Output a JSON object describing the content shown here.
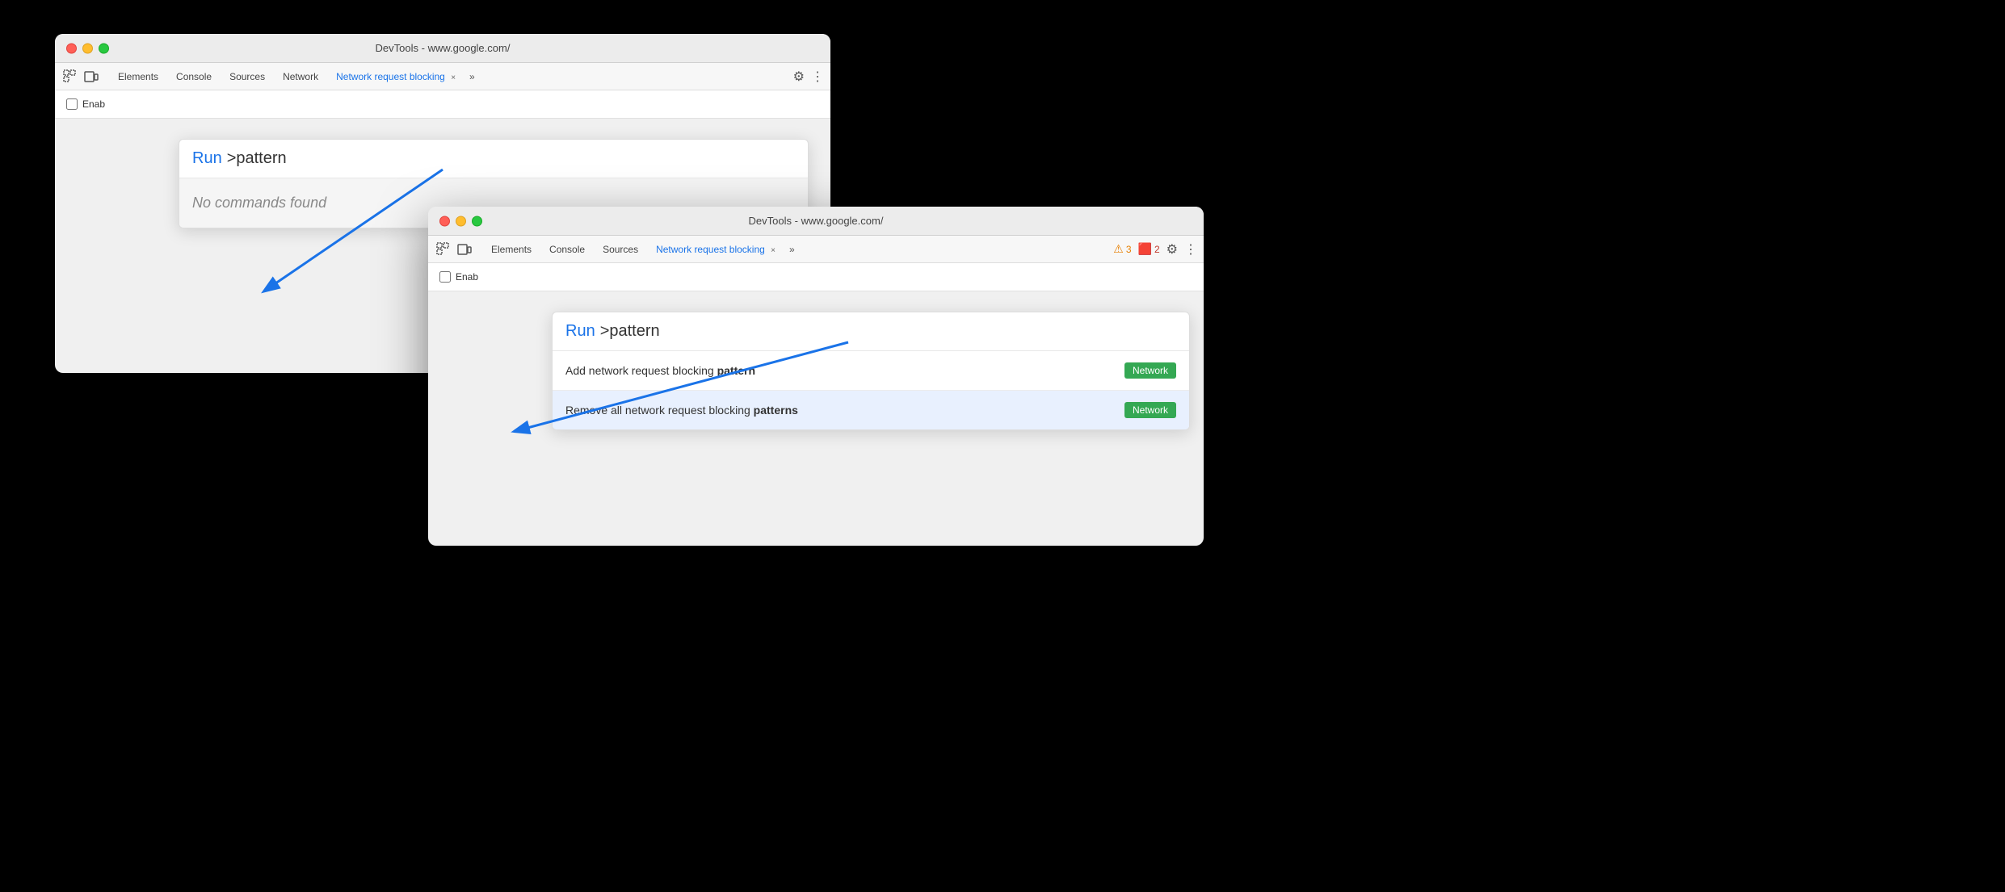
{
  "window1": {
    "titlebar": "DevTools - www.google.com/",
    "tabs": [
      {
        "label": "Elements",
        "active": false
      },
      {
        "label": "Console",
        "active": false
      },
      {
        "label": "Sources",
        "active": false
      },
      {
        "label": "Network",
        "active": false
      },
      {
        "label": "Network request blocking",
        "active": true
      }
    ],
    "tab_close": "×",
    "tab_more": "»",
    "settings_icon": "⚙",
    "more_icon": "⋮",
    "enable_label": "Enab",
    "cmd_palette": {
      "run_label": "Run",
      "cmd_text": ">pattern",
      "no_results": "No commands found"
    }
  },
  "window2": {
    "titlebar": "DevTools - www.google.com/",
    "tabs": [
      {
        "label": "Elements",
        "active": false
      },
      {
        "label": "Console",
        "active": false
      },
      {
        "label": "Sources",
        "active": false
      },
      {
        "label": "Network request blocking",
        "active": true
      }
    ],
    "tab_close": "×",
    "tab_more": "»",
    "settings_icon": "⚙",
    "more_icon": "⋮",
    "warn_count": "3",
    "err_count": "2",
    "enable_label": "Enab",
    "cmd_palette": {
      "run_label": "Run",
      "cmd_text": ">pattern",
      "results": [
        {
          "text_prefix": "Add network request blocking ",
          "text_bold": "pattern",
          "text_suffix": "",
          "badge": "Network",
          "highlighted": false
        },
        {
          "text_prefix": "Remove all network request blocking ",
          "text_bold": "patterns",
          "text_suffix": "",
          "badge": "Network",
          "highlighted": true
        }
      ]
    }
  },
  "icons": {
    "cursor_select": "⬚",
    "device_toggle": "⬜"
  }
}
